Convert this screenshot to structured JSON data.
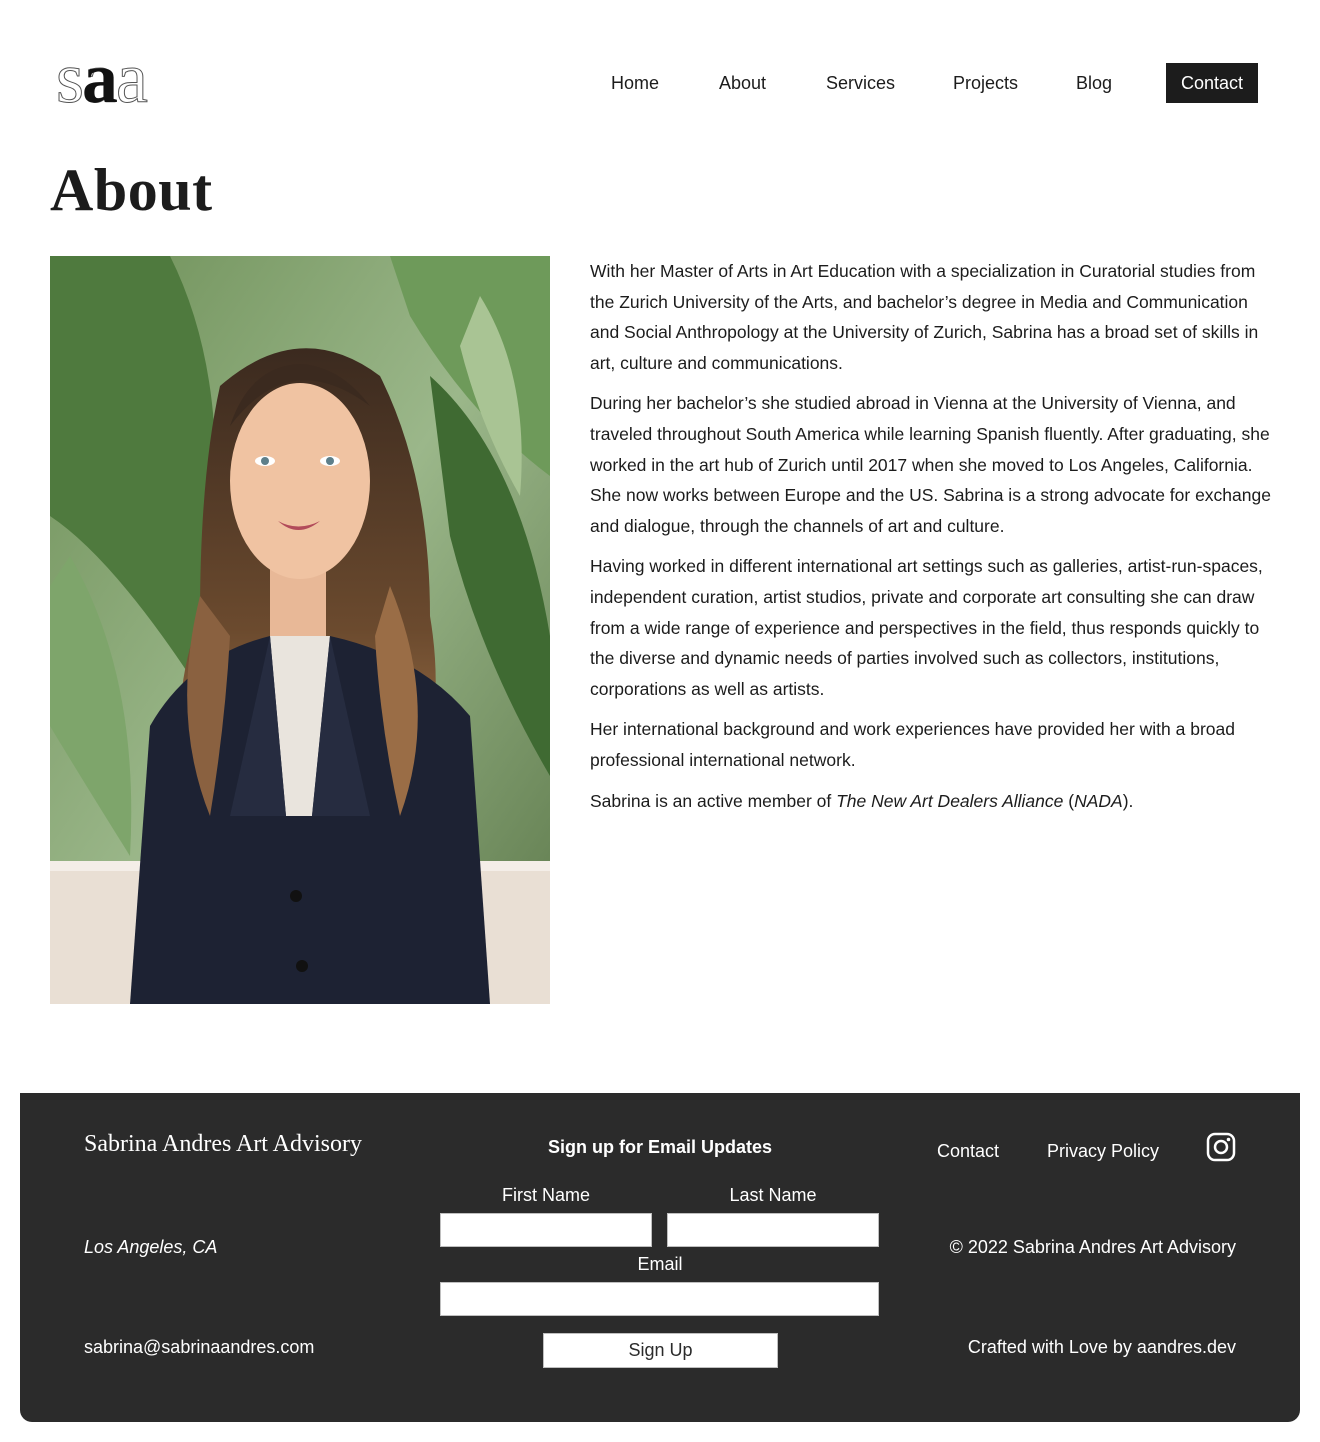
{
  "header": {
    "logo_text": "saa",
    "nav": [
      {
        "label": "Home"
      },
      {
        "label": "About"
      },
      {
        "label": "Services"
      },
      {
        "label": "Projects"
      },
      {
        "label": "Blog"
      },
      {
        "label": "Contact"
      }
    ]
  },
  "page": {
    "title": "About"
  },
  "bio": {
    "p1": "With her Master of Arts in Art Education with a specialization in Curatorial studies from the Zurich University of the Arts, and bachelor’s degree in Media and Communication and Social Anthropology at the University of Zurich, Sabrina has a broad set of skills in art, culture and communications.",
    "p2": "During her bachelor’s she studied abroad in Vienna at the University of Vienna, and traveled throughout South America while learning Spanish fluently. After graduating, she worked in the art hub of Zurich until 2017 when she moved to Los Angeles, California. She now works between Europe and the US. Sabrina is a strong advocate for exchange and dialogue, through the channels of art and culture.",
    "p3": "Having worked in different international art settings such as galleries, artist-run-spaces, independent curation, artist studios, private and corporate art consulting she can draw from a wide range of experience and perspectives in the field, thus responds quickly to the diverse and dynamic needs of parties involved such as collectors, institutions, corporations as well as artists.",
    "p4": "Her international background and work experiences have provided her with a broad professional international network.",
    "p5_prefix": "Sabrina is an active member of ",
    "p5_org": "The New Art Dealers Alliance",
    "p5_open": " (",
    "p5_abbr": "NADA",
    "p5_close": ")."
  },
  "footer": {
    "brand": "Sabrina Andres Art Advisory",
    "location": "Los Angeles, CA",
    "email": "sabrina@sabrinaandres.com",
    "signup": {
      "title": "Sign up for Email Updates",
      "first_name_label": "First Name",
      "last_name_label": "Last Name",
      "email_label": "Email",
      "first_name_value": "",
      "last_name_value": "",
      "email_value": "",
      "button_label": "Sign Up"
    },
    "links": {
      "contact": "Contact",
      "privacy": "Privacy Policy"
    },
    "social_icon": "instagram-icon",
    "copyright": "© 2022 Sabrina Andres Art Advisory",
    "crafted": "Crafted with Love by aandres.dev"
  },
  "colors": {
    "text": "#1c1c1c",
    "footer_bg": "#2b2b2b",
    "button_bg": "#1c1c1c"
  }
}
